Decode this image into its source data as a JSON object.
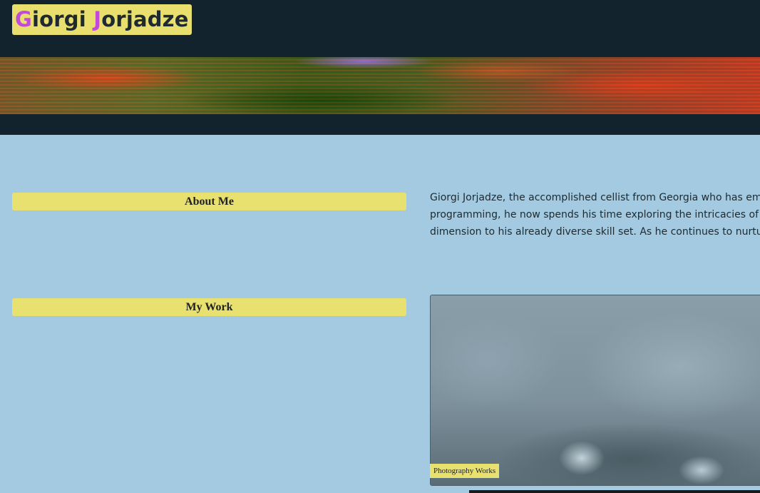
{
  "header": {
    "logo_first_initial": "G",
    "logo_first_rest": "iorgi ",
    "logo_last_initial": "J",
    "logo_last_rest": "orjadze"
  },
  "sections": {
    "about": {
      "title": "About Me",
      "lines": [
        "Giorgi Jorjadze, the accomplished cellist from Georgia who has embrac",
        "programming, he now spends his time exploring the intricacies of codi",
        "dimension to his already diverse skill set. As he continues to nurture h"
      ]
    },
    "work": {
      "title": "My Work",
      "card_label": "Photography Works"
    }
  },
  "colors": {
    "header_bg": "#12232e",
    "page_bg": "#a3cae0",
    "accent_yellow": "#e8e170",
    "logo_initial": "#c14bd6"
  }
}
